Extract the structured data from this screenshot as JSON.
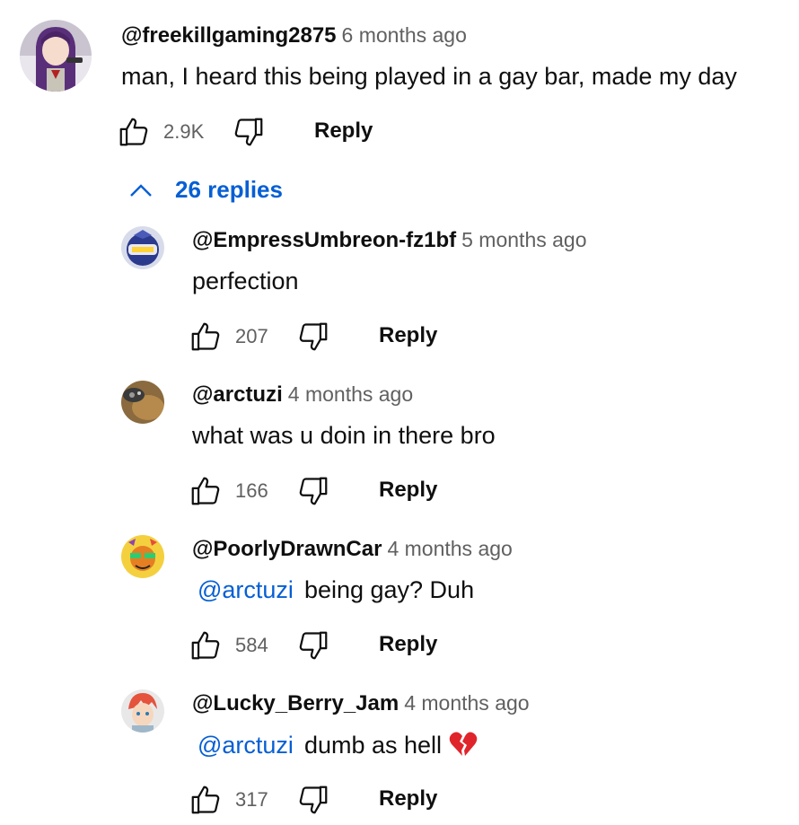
{
  "top_comment": {
    "handle": "@freekillgaming2875",
    "time": "6 months ago",
    "text": "man, I heard this being played in a gay bar, made my day",
    "likes": "2.9K",
    "reply_label": "Reply"
  },
  "replies_toggle": {
    "label": "26 replies"
  },
  "replies": [
    {
      "handle": "@EmpressUmbreon-fz1bf",
      "time": "5 months ago",
      "mention": "",
      "text": "perfection",
      "likes": "207",
      "reply_label": "Reply"
    },
    {
      "handle": "@arctuzi",
      "time": "4 months ago",
      "mention": "",
      "text": "what was u doin in there bro",
      "likes": "166",
      "reply_label": "Reply"
    },
    {
      "handle": "@PoorlyDrawnCar",
      "time": "4 months ago",
      "mention": "@arctuzi",
      "text": "being gay? Duh",
      "likes": "584",
      "reply_label": "Reply"
    },
    {
      "handle": "@Lucky_Berry_Jam",
      "time": "4 months ago",
      "mention": "@arctuzi",
      "text": "dumb as hell",
      "likes": "317",
      "reply_label": "Reply"
    }
  ],
  "colors": {
    "link": "#065fd4",
    "secondary": "#606060",
    "primary": "#0f0f0f"
  },
  "icons": [
    "thumbs-up-icon",
    "thumbs-down-icon",
    "chevron-up-icon",
    "broken-heart-icon"
  ]
}
